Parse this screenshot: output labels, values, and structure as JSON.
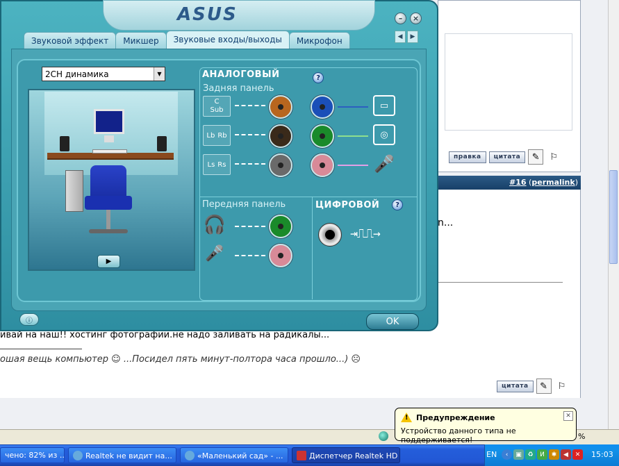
{
  "browser": {
    "post_permalink_num": "#16",
    "post_permalink_label": "permalink",
    "edit_btn": "правка",
    "quote_btn": "цитата",
    "quote_btn2": "цитата",
    "post_snip": "n...",
    "post_text": "ивай на наш!! хостинг фотографии.не надо заливать на радикалы...",
    "signature": "ошая вещь компьютер",
    "signature_tail": "...Посидел пять минут-полтора часа прошло...)",
    "status_zoom": "%"
  },
  "realtek": {
    "logo": "ASUS",
    "tabs": [
      "Звуковой эффект",
      "Микшер",
      "Звуковые входы/выходы",
      "Микрофон"
    ],
    "active_tab": 2,
    "speaker_config": "2CH динамика",
    "analog_title": "АНАЛОГОВЫЙ",
    "rear_panel": "Задняя панель",
    "front_panel": "Передняя панель",
    "digital_title": "ЦИФРОВОЙ",
    "rear_labels": {
      "center": "C",
      "sub": "Sub",
      "lb": "Lb",
      "rb": "Rb",
      "ls": "Ls",
      "rs": "Rs"
    },
    "ok_label": "OK",
    "jack_colors": {
      "orange": "#b8661f",
      "black": "#3a2a1a",
      "gray": "#6a6a6a",
      "blue": "#1b4fb8",
      "green": "#1a8a2a",
      "pink": "#d88a98"
    }
  },
  "balloon": {
    "title": "Предупреждение",
    "message": "Устройство данного типа не поддерживается!"
  },
  "taskbar": {
    "tasks": [
      "чено: 82% из ...",
      "Realtek не видит на...",
      "«Маленький сад» - ...",
      "Диспетчер Realtek HD"
    ],
    "lang": "EN",
    "clock": "15:03"
  }
}
